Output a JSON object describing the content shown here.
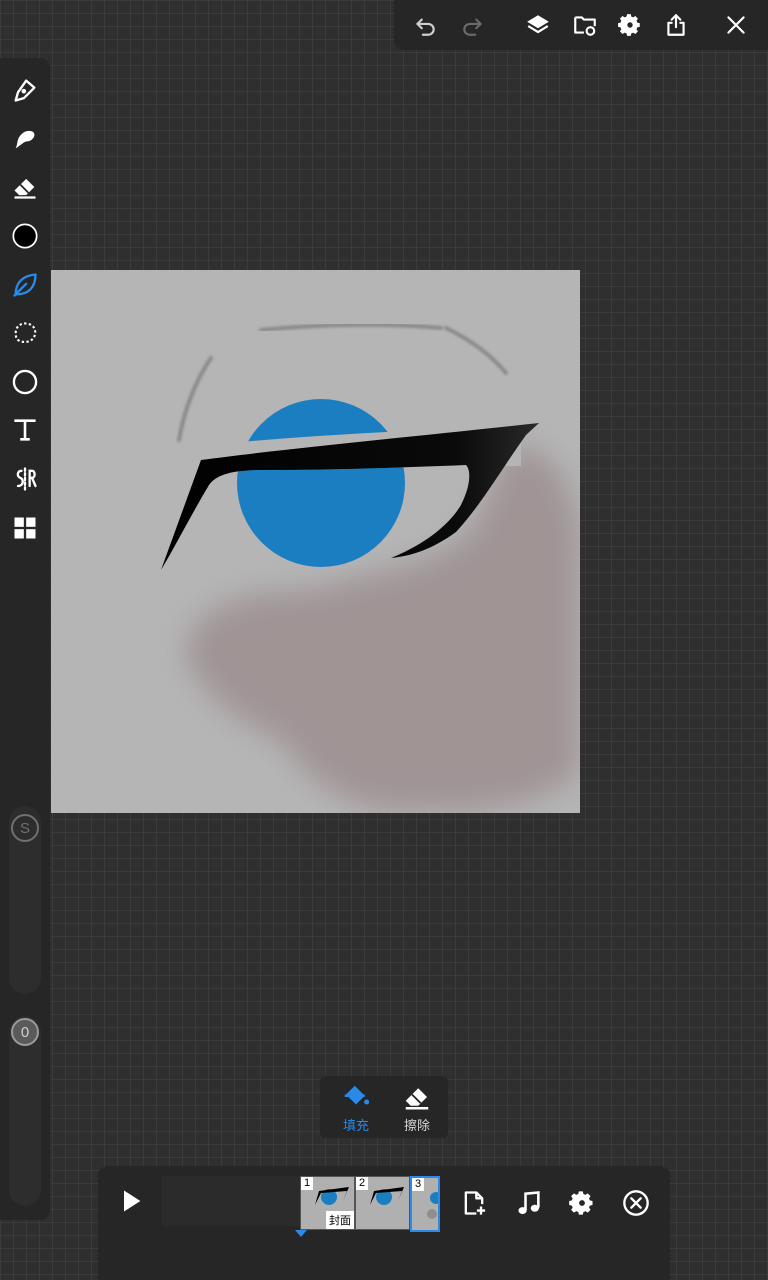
{
  "top_toolbar": {
    "icons": [
      "undo-icon",
      "redo-icon",
      "layers-icon",
      "folder-refresh-icon",
      "gear-icon",
      "share-icon",
      "close-icon"
    ]
  },
  "sidebar": {
    "tools": [
      "pen-icon",
      "smudge-icon",
      "eraser-icon",
      "color-swatch",
      "lasso-leaf-icon",
      "selection-icon",
      "shape-circle-icon",
      "text-icon",
      "symmetry-icon",
      "grid-icon"
    ],
    "active_tool": "lasso-leaf-icon",
    "current_color": "#000000",
    "size_slider": {
      "label": "S"
    },
    "opacity_slider": {
      "label": "0"
    }
  },
  "fill_panel": {
    "fill_label": "填充",
    "erase_label": "擦除",
    "active": "fill"
  },
  "timeline": {
    "frames": [
      {
        "number": "1",
        "cover_label": "封面"
      },
      {
        "number": "2"
      },
      {
        "number": "3"
      }
    ],
    "selected_frame": 3,
    "icons": [
      "play-icon",
      "add-frame-icon",
      "music-icon",
      "gear-icon",
      "close-circle-icon"
    ]
  },
  "colors": {
    "accent": "#2a8ae6",
    "iris": "#1b7ec1",
    "canvas_bg": "#b5b5b5",
    "shadow_brush": "#9f9394"
  }
}
